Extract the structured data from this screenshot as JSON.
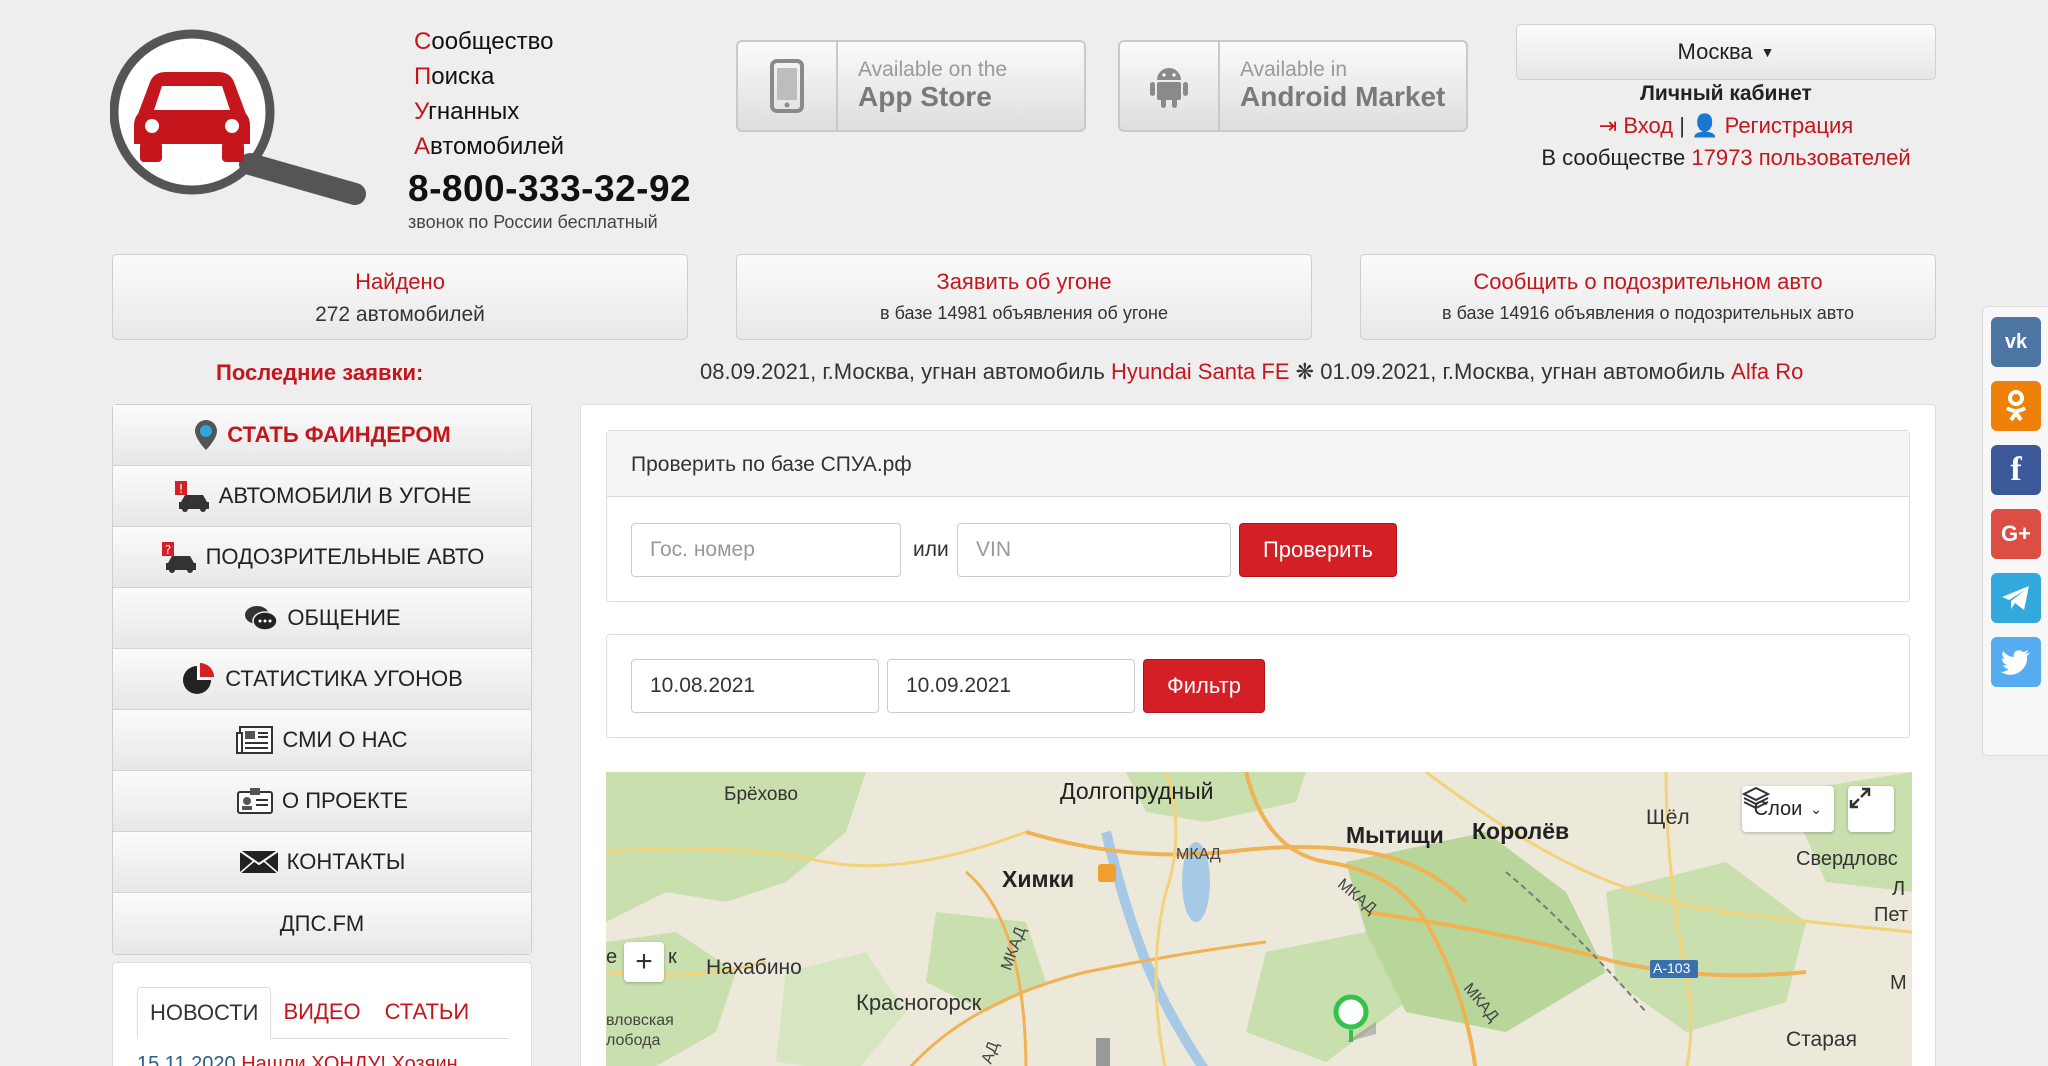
{
  "brand": {
    "line1_cap": "С",
    "line1_rest": "ообщество",
    "line2_cap": "П",
    "line2_rest": "оиска",
    "line3_cap": "У",
    "line3_rest": "гнанных",
    "line4_cap": "А",
    "line4_rest": "втомобилей",
    "phone": "8-800-333-32-92",
    "phone_note": "звонок по России бесплатный"
  },
  "stores": {
    "apple_small": "Available on the",
    "apple_big": "App Store",
    "android_small": "Available in",
    "android_big": "Android Market"
  },
  "account": {
    "city": "Москва",
    "cabinet_title": "Личный кабинет",
    "login": "Вход",
    "separator": "|",
    "register": "Регистрация",
    "community_prefix": "В сообществе",
    "community_count": "17973 пользователей"
  },
  "stats": {
    "found_title": "Найдено",
    "found_value": "272 автомобилей",
    "report_title": "Заявить об угоне",
    "report_value": "в базе 14981 объявления об угоне",
    "suspicious_title": "Сообщить о подозрительном авто",
    "suspicious_value": "в базе 14916 объявления о подозрительных авто"
  },
  "latest": {
    "label": "Последние заявки:",
    "item1_text": "08.09.2021, г.Москва, угнан автомобиль",
    "item1_link": "Hyundai Santa FE",
    "sep": "❋",
    "item2_text": "01.09.2021, г.Москва, угнан автомобиль",
    "item2_link": "Alfa Ro"
  },
  "menu": {
    "items": [
      {
        "label": "СТАТЬ ФАИНДЕРОМ"
      },
      {
        "label": "АВТОМОБИЛИ В УГОНЕ"
      },
      {
        "label": "ПОДОЗРИТЕЛЬНЫЕ АВТО"
      },
      {
        "label": "ОБЩЕНИЕ"
      },
      {
        "label": "СТАТИСТИКА УГОНОВ"
      },
      {
        "label": "СМИ О НАС"
      },
      {
        "label": "О ПРОЕКТЕ"
      },
      {
        "label": "КОНТАКТЫ"
      },
      {
        "label": "ДПС.FM"
      }
    ]
  },
  "news": {
    "tabs": [
      "НОВОСТИ",
      "ВИДЕО",
      "СТАТЬИ"
    ],
    "first_date": "15.11.2020",
    "first_title": "Нашли ХОНДУ! Хозяин"
  },
  "check": {
    "title": "Проверить по базе СПУА.рф",
    "plate_placeholder": "Гос. номер",
    "or": "или",
    "vin_placeholder": "VIN",
    "button": "Проверить"
  },
  "filter": {
    "date_from": "10.08.2021",
    "date_to": "10.09.2021",
    "button": "Фильтр"
  },
  "map": {
    "layers_label": "Слои",
    "labels": {
      "brekhovo": "Брёхово",
      "dolgoprudny": "Долгопрудный",
      "mytishchi": "Мытищи",
      "korolev": "Королёв",
      "shchyolkovo": "Щёл",
      "sverdlovsky": "Свердловс",
      "khimki": "Химки",
      "mkad1": "МКАД",
      "mkad2": "МКАД",
      "mkad3": "МКАД",
      "mkad4": "МКАД",
      "nakhabino": "Нахабино",
      "krasnogorsk": "Красногорск",
      "a103": "А-103",
      "staraya": "Старая",
      "sloboda1": "вловская",
      "sloboda2": "лобода",
      "edge_left": "е",
      "edge_k": "к",
      "edge_l": "Л",
      "edge_pet": "Пет",
      "edge_m": "М",
      "edge_ad": "АД"
    }
  },
  "social": [
    "vk",
    "ok",
    "facebook",
    "google-plus",
    "telegram",
    "twitter"
  ],
  "colors": {
    "brand_red": "#c4161c",
    "button_red": "#d41f26",
    "vk": "#4c75a3",
    "ok": "#ee8208",
    "facebook": "#3b5998",
    "google": "#dc4e41",
    "telegram": "#32a8dd",
    "twitter": "#55acee"
  }
}
